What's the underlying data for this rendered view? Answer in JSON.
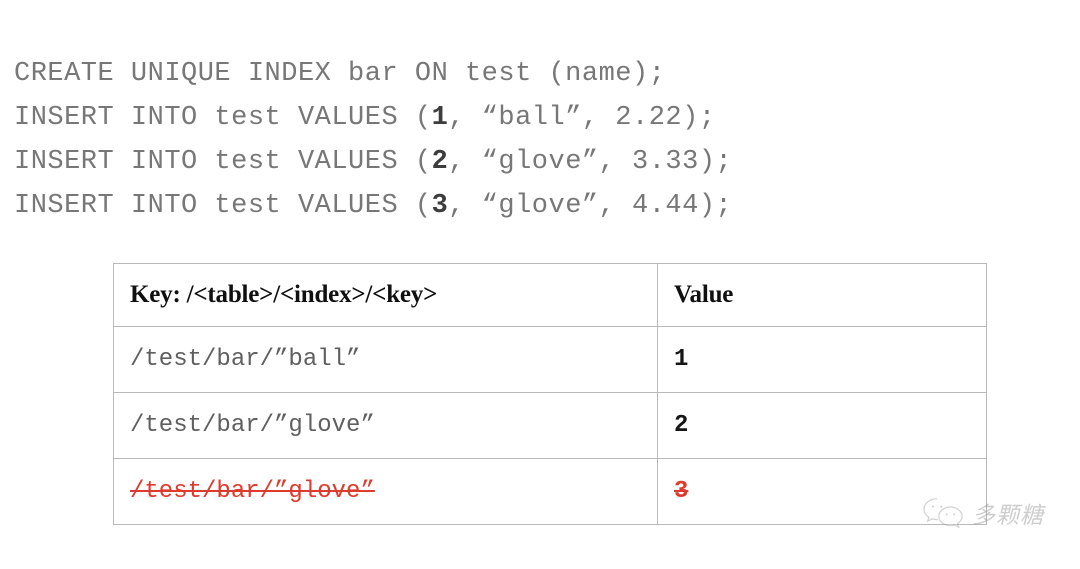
{
  "code": {
    "lines": [
      {
        "pre": "CREATE UNIQUE INDEX bar ON test (name);",
        "num": "",
        "post": ""
      },
      {
        "pre": "INSERT INTO test VALUES (",
        "num": "1",
        "post": ", “ball”, 2.22);"
      },
      {
        "pre": "INSERT INTO test VALUES (",
        "num": "2",
        "post": ", “glove”, 3.33);"
      },
      {
        "pre": "INSERT INTO test VALUES (",
        "num": "3",
        "post": ", “glove”, 4.44);"
      }
    ]
  },
  "table": {
    "headers": {
      "key": "Key: /<table>/<index>/<key>",
      "value": "Value"
    },
    "rows": [
      {
        "key": "/test/bar/”ball”",
        "value": "1",
        "deleted": false
      },
      {
        "key": "/test/bar/”glove”",
        "value": "2",
        "deleted": false
      },
      {
        "key": "/test/bar/”glove”",
        "value": "3",
        "deleted": true
      }
    ]
  },
  "watermark": {
    "text": "多颗糖",
    "icon": "wechat-icon"
  },
  "colors": {
    "code_text": "#777777",
    "code_number": "#3d3d3d",
    "table_border": "#b9b9b9",
    "deleted_red": "#dd3b2d",
    "header_text": "#101010",
    "background": "#ffffff"
  }
}
